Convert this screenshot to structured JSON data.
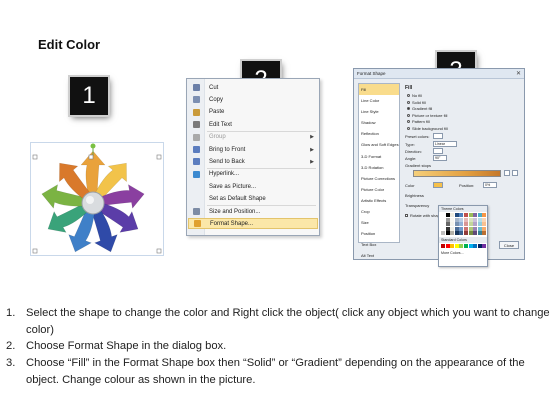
{
  "title": "Edit Color",
  "steps": [
    "1",
    "2",
    "3"
  ],
  "context_menu": {
    "items": [
      {
        "label": "Cut",
        "icon": "scissors-icon",
        "color": "#6b7fa8"
      },
      {
        "label": "Copy",
        "icon": "copy-icon",
        "color": "#7c8fb2"
      },
      {
        "label": "Paste",
        "icon": "clipboard-icon",
        "color": "#c99a3a"
      },
      {
        "label": "Edit Text",
        "icon": "edit-text-icon",
        "color": "#7a7a7a"
      },
      {
        "label": "Group",
        "icon": "group-icon",
        "color": "#a9a9a9",
        "disabled": true,
        "submenu": true
      },
      {
        "label": "Bring to Front",
        "icon": "bring-to-front-icon",
        "color": "#5b7dbf",
        "submenu": true
      },
      {
        "label": "Send to Back",
        "icon": "send-to-back-icon",
        "color": "#5b7dbf",
        "submenu": true
      },
      {
        "label": "Hyperlink...",
        "icon": "globe-icon",
        "color": "#3c8ad0"
      },
      {
        "label": "Save as Picture...",
        "icon": "",
        "color": ""
      },
      {
        "label": "Set as Default Shape",
        "icon": "",
        "color": ""
      },
      {
        "label": "Size and Position...",
        "icon": "size-position-icon",
        "color": "#7d8ca5"
      },
      {
        "label": "Format Shape...",
        "icon": "format-shape-icon",
        "color": "#e0a02e",
        "highlighted": true
      }
    ]
  },
  "dialog": {
    "title": "Format Shape",
    "close": "✕",
    "categories": [
      "Fill",
      "Line Color",
      "Line Style",
      "Shadow",
      "Reflection",
      "Glow and Soft Edges",
      "3-D Format",
      "3-D Rotation",
      "Picture Corrections",
      "Picture Color",
      "Artistic Effects",
      "Crop",
      "Size",
      "Position",
      "Text Box",
      "Alt Text"
    ],
    "selected_category": "Fill",
    "section": "Fill",
    "fill_options": [
      "No fill",
      "Solid fill",
      "Gradient fill",
      "Picture or texture fill",
      "Pattern fill",
      "Slide background fill"
    ],
    "selected_fill": "Gradient fill",
    "preset_label": "Preset colors:",
    "type_label": "Type:",
    "type_value": "Linear",
    "direction_label": "Direction:",
    "angle_label": "Angle:",
    "angle_value": "90°",
    "gradient_label": "Gradient stops",
    "color_label": "Color",
    "position_label": "Position:",
    "position_value": "0%",
    "brightness_label": "Brightness",
    "transparency_label": "Transparency",
    "rotate_label": "Rotate with shape",
    "theme_colors": "Theme Colors",
    "standard_colors": "Standard Colors",
    "more_colors": "More Colors...",
    "close_button": "Close"
  },
  "instructions": [
    {
      "num": "1.",
      "text": "Select the shape to change the color and Right click the object( click any object which you want to change color)"
    },
    {
      "num": "2.",
      "text": "Choose Format Shape in the dialog box."
    },
    {
      "num": "3.",
      "text": "Choose “Fill” in the Format Shape box then “Solid” or “Gradient” depending on the appearance of the object. Change colour as shown in the picture."
    }
  ],
  "colors": {
    "arrows": [
      "#e9a23b",
      "#f2c34a",
      "#8a3fa0",
      "#5b3da8",
      "#2f4aa8",
      "#3f80c8",
      "#3aa37a",
      "#7bb343",
      "#d9792b"
    ],
    "theme_palette": [
      "#ffffff",
      "#000000",
      "#eeece1",
      "#1f497d",
      "#4f81bd",
      "#c0504d",
      "#9bbb59",
      "#8064a2",
      "#4bacc6",
      "#f79646"
    ],
    "standard_palette": [
      "#c00000",
      "#ff0000",
      "#ffc000",
      "#ffff00",
      "#92d050",
      "#00b050",
      "#00b0f0",
      "#0070c0",
      "#002060",
      "#7030a0"
    ]
  }
}
